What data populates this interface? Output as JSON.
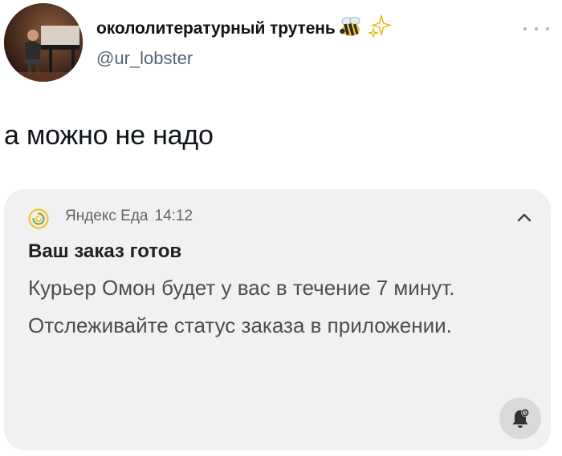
{
  "tweet": {
    "display_name": "окололитературный трутень",
    "emojis": [
      "bee-icon",
      "sparkles-icon"
    ],
    "handle": "@ur_lobster",
    "text": "а можно не надо",
    "more_icon": "more-dots-icon"
  },
  "notification": {
    "app_icon": "yandex-eda-logo-icon",
    "app_name": "Яндекс Еда",
    "time": "14:12",
    "collapse_icon": "chevron-up-icon",
    "title": "Ваш заказ готов",
    "body": "Курьер Омон будет у вас в течение 7 минут. Отслеживайте статус заказа в приложении.",
    "action_icon": "bell-snooze-icon"
  },
  "colors": {
    "handle": "#536471",
    "card_background": "#f1f1f1",
    "app_accent": "#f5c12e",
    "bell_button": "#d9d9d9"
  }
}
